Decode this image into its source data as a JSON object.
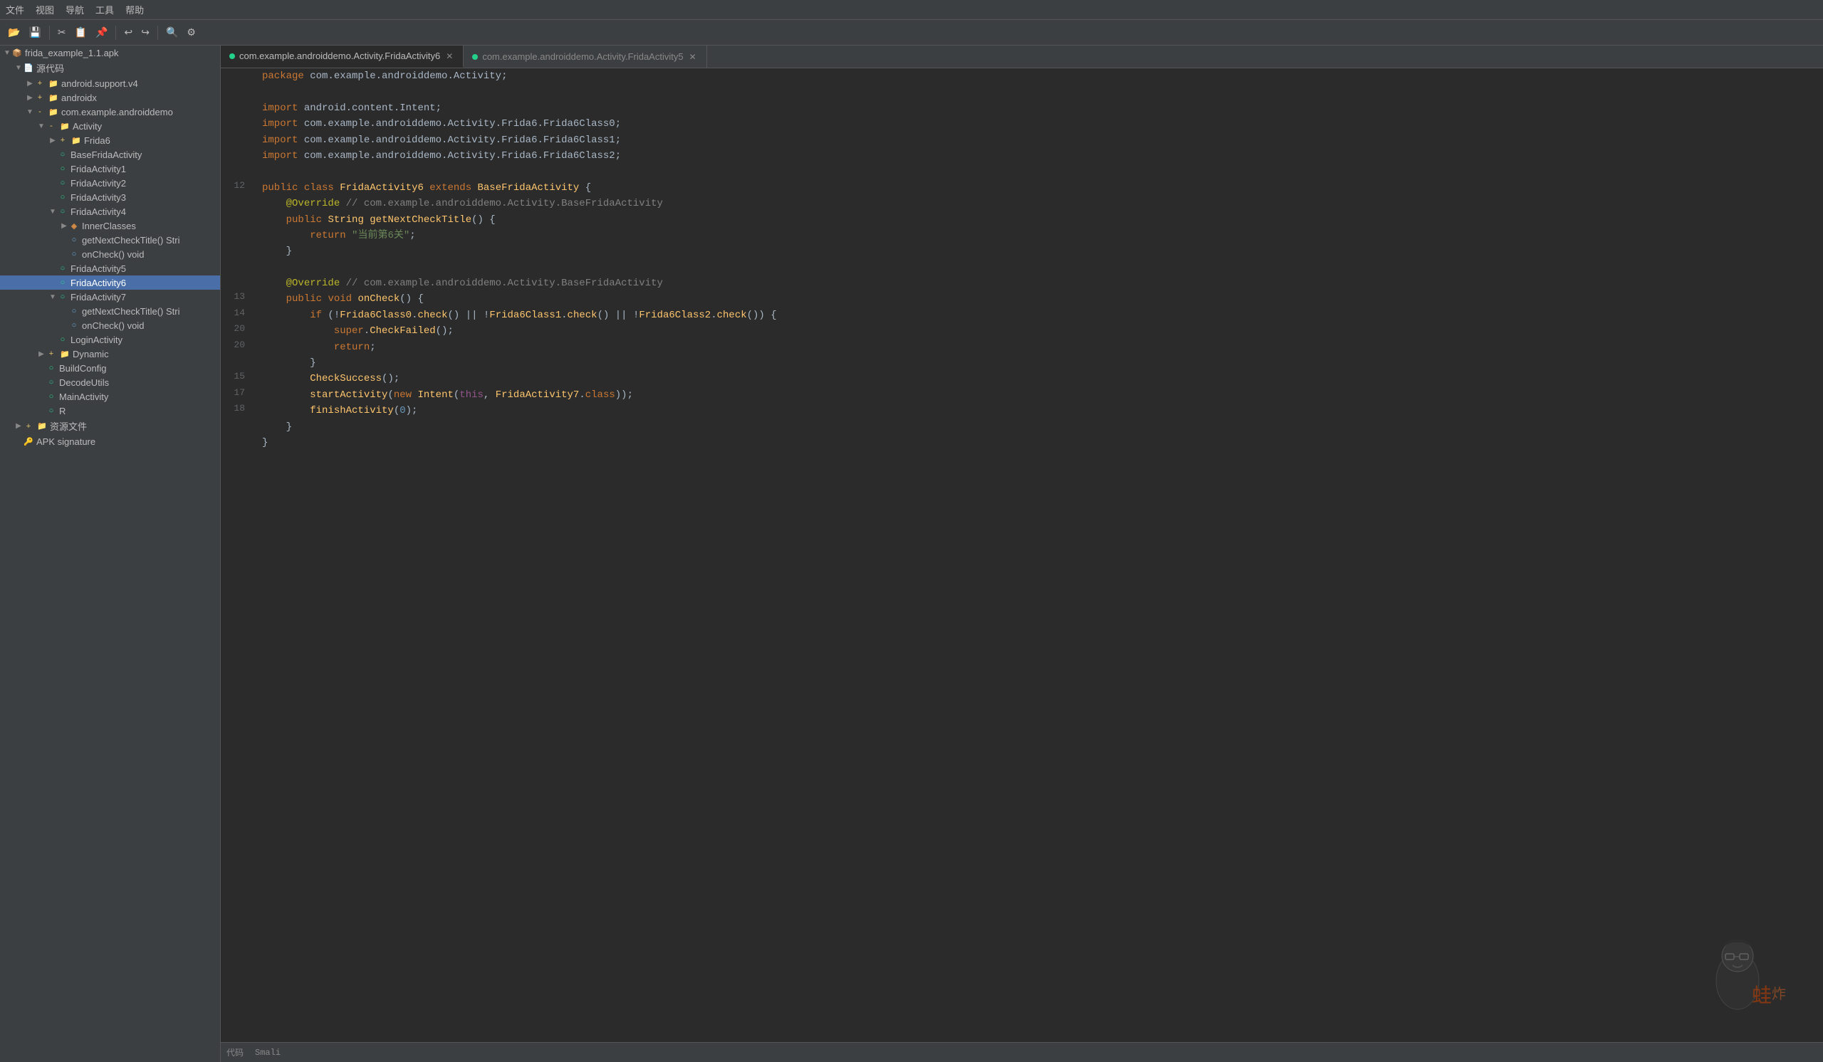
{
  "menubar": {
    "items": [
      "文件",
      "视图",
      "导航",
      "工具",
      "帮助"
    ]
  },
  "toolbar": {
    "buttons": [
      "📁",
      "💾",
      "✂️",
      "📋",
      "📌",
      "↩",
      "↪",
      "🔍",
      "⚙️"
    ]
  },
  "sidebar": {
    "root_label": "frida_example_1.1.apk",
    "nodes": [
      {
        "id": "root",
        "label": "frida_example_1.1.apk",
        "indent": 0,
        "type": "apk",
        "expanded": true,
        "arrow": "▼"
      },
      {
        "id": "source",
        "label": "源代码",
        "indent": 1,
        "type": "source",
        "expanded": true,
        "arrow": "▼"
      },
      {
        "id": "android_support",
        "label": "android.support.v4",
        "indent": 2,
        "type": "package",
        "expanded": false,
        "arrow": "▶"
      },
      {
        "id": "androidx",
        "label": "androidx",
        "indent": 2,
        "type": "package",
        "expanded": false,
        "arrow": "▶"
      },
      {
        "id": "com_example",
        "label": "com.example.androiddemo",
        "indent": 2,
        "type": "package",
        "expanded": true,
        "arrow": "▼"
      },
      {
        "id": "activity_folder",
        "label": "Activity",
        "indent": 3,
        "type": "folder",
        "expanded": true,
        "arrow": "▼"
      },
      {
        "id": "frida6_folder",
        "label": "Frida6",
        "indent": 4,
        "type": "folder",
        "expanded": false,
        "arrow": "▶"
      },
      {
        "id": "base_frida",
        "label": "BaseFridaActivity",
        "indent": 4,
        "type": "class",
        "expanded": false,
        "arrow": ""
      },
      {
        "id": "frida1",
        "label": "FridaActivity1",
        "indent": 4,
        "type": "class",
        "expanded": false,
        "arrow": ""
      },
      {
        "id": "frida2",
        "label": "FridaActivity2",
        "indent": 4,
        "type": "class",
        "expanded": false,
        "arrow": ""
      },
      {
        "id": "frida3",
        "label": "FridaActivity3",
        "indent": 4,
        "type": "class",
        "expanded": false,
        "arrow": ""
      },
      {
        "id": "frida4",
        "label": "FridaActivity4",
        "indent": 4,
        "type": "class",
        "expanded": true,
        "arrow": "▼"
      },
      {
        "id": "inner_classes",
        "label": "InnerClasses",
        "indent": 5,
        "type": "inner",
        "expanded": false,
        "arrow": "▶"
      },
      {
        "id": "frida4_method1",
        "label": "getNextCheckTitle() Stri",
        "indent": 5,
        "type": "method",
        "expanded": false,
        "arrow": ""
      },
      {
        "id": "frida4_method2",
        "label": "onCheck() void",
        "indent": 5,
        "type": "method",
        "expanded": false,
        "arrow": ""
      },
      {
        "id": "frida5",
        "label": "FridaActivity5",
        "indent": 4,
        "type": "class",
        "expanded": false,
        "arrow": ""
      },
      {
        "id": "frida6",
        "label": "FridaActivity6",
        "indent": 4,
        "type": "class",
        "expanded": false,
        "arrow": "",
        "selected": true
      },
      {
        "id": "frida7",
        "label": "FridaActivity7",
        "indent": 4,
        "type": "class",
        "expanded": true,
        "arrow": "▼"
      },
      {
        "id": "frida7_method1",
        "label": "getNextCheckTitle() Stri",
        "indent": 5,
        "type": "method",
        "expanded": false,
        "arrow": ""
      },
      {
        "id": "frida7_method2",
        "label": "onCheck() void",
        "indent": 5,
        "type": "method",
        "expanded": false,
        "arrow": ""
      },
      {
        "id": "login_activity",
        "label": "LoginActivity",
        "indent": 4,
        "type": "class",
        "expanded": false,
        "arrow": ""
      },
      {
        "id": "dynamic",
        "label": "Dynamic",
        "indent": 3,
        "type": "folder",
        "expanded": false,
        "arrow": "▶"
      },
      {
        "id": "build_config",
        "label": "BuildConfig",
        "indent": 3,
        "type": "class",
        "expanded": false,
        "arrow": ""
      },
      {
        "id": "decode_utils",
        "label": "DecodeUtils",
        "indent": 3,
        "type": "class",
        "expanded": false,
        "arrow": ""
      },
      {
        "id": "main_activity",
        "label": "MainActivity",
        "indent": 3,
        "type": "class",
        "expanded": false,
        "arrow": ""
      },
      {
        "id": "r_class",
        "label": "R",
        "indent": 3,
        "type": "class",
        "expanded": false,
        "arrow": ""
      },
      {
        "id": "resources",
        "label": "资源文件",
        "indent": 1,
        "type": "folder",
        "expanded": false,
        "arrow": "▶"
      },
      {
        "id": "apk_sig",
        "label": "APK signature",
        "indent": 1,
        "type": "key",
        "expanded": false,
        "arrow": ""
      }
    ]
  },
  "tabs": [
    {
      "id": "tab1",
      "label": "com.example.androiddemo.Activity.FridaActivity6",
      "active": true,
      "dot_color": "#23d18b"
    },
    {
      "id": "tab2",
      "label": "com.example.androiddemo.Activity.FridaActivity5",
      "active": false,
      "dot_color": "#23d18b"
    }
  ],
  "code": {
    "lines": [
      {
        "num": "",
        "content": "package com.example.androiddemo.Activity;"
      },
      {
        "num": "",
        "content": ""
      },
      {
        "num": "",
        "content": "import android.content.Intent;"
      },
      {
        "num": "",
        "content": "import com.example.androiddemo.Activity.Frida6.Frida6Class0;"
      },
      {
        "num": "",
        "content": "import com.example.androiddemo.Activity.Frida6.Frida6Class1;"
      },
      {
        "num": "",
        "content": "import com.example.androiddemo.Activity.Frida6.Frida6Class2;"
      },
      {
        "num": "",
        "content": ""
      },
      {
        "num": "12",
        "content": "public class FridaActivity6 extends BaseFridaActivity {"
      },
      {
        "num": "",
        "content": "    @Override // com.example.androiddemo.Activity.BaseFridaActivity"
      },
      {
        "num": "",
        "content": "    public String getNextCheckTitle() {"
      },
      {
        "num": "",
        "content": "        return \"当前第6关\";"
      },
      {
        "num": "",
        "content": "    }"
      },
      {
        "num": "",
        "content": ""
      },
      {
        "num": "",
        "content": "    @Override // com.example.androiddemo.Activity.BaseFridaActivity"
      },
      {
        "num": "13",
        "content": "    public void onCheck() {"
      },
      {
        "num": "14",
        "content": "        if (!Frida6Class0.check() || !Frida6Class1.check() || !Frida6Class2.check()) {"
      },
      {
        "num": "20",
        "content": "            super.CheckFailed();"
      },
      {
        "num": "20",
        "content": "            return;"
      },
      {
        "num": "",
        "content": "        }"
      },
      {
        "num": "15",
        "content": "        CheckSuccess();"
      },
      {
        "num": "17",
        "content": "        startActivity(new Intent(this, FridaActivity7.class));"
      },
      {
        "num": "18",
        "content": "        finishActivity(0);"
      },
      {
        "num": "",
        "content": "    }"
      },
      {
        "num": "",
        "content": "}"
      }
    ]
  },
  "status_bar": {
    "left": "代码",
    "right": "Smali"
  }
}
